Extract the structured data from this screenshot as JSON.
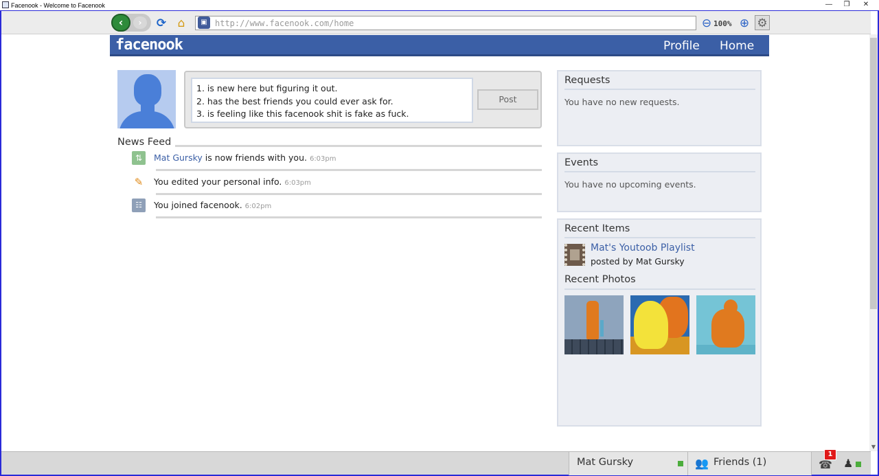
{
  "window": {
    "title": "Facenook - Welcome to Facenook",
    "minimize_glyph": "—",
    "restore_glyph": "❐",
    "close_glyph": "✕"
  },
  "browser": {
    "back_glyph": "‹",
    "forward_glyph": "›",
    "refresh_glyph": "⟳",
    "home_glyph": "⌂",
    "lock_glyph": "▣",
    "url": "http://www.facenook.com/home",
    "zoom_out_glyph": "⊖",
    "zoom": "100%",
    "zoom_in_glyph": "⊕",
    "settings_glyph": "⚙"
  },
  "site": {
    "logo": "facenook",
    "nav": {
      "profile": "Profile",
      "home": "Home"
    }
  },
  "status": {
    "lines": [
      "1. is new here but figuring it out.",
      "2. has the best friends you could ever ask for.",
      "3. is feeling like this facenook shit is fake as fuck."
    ],
    "post_label": "Post"
  },
  "news_feed": {
    "title": "News Feed",
    "items": [
      {
        "icon": "friend-icon",
        "glyph": "⇅",
        "link": "Mat Gursky",
        "text": " is now friends with you.",
        "time": "6:03pm"
      },
      {
        "icon": "pencil-icon",
        "glyph": "✎",
        "link": "",
        "text": "You edited your personal info.",
        "time": "6:03pm"
      },
      {
        "icon": "join-icon",
        "glyph": "☷",
        "link": "",
        "text": "You joined facenook.",
        "time": "6:02pm"
      }
    ]
  },
  "sidebar": {
    "requests": {
      "title": "Requests",
      "text": "You have no new requests."
    },
    "events": {
      "title": "Events",
      "text": "You have no upcoming events."
    },
    "recent_items": {
      "title": "Recent Items",
      "item_title": "Mat's Youtoob Playlist",
      "item_sub": "posted by Mat Gursky"
    },
    "recent_photos": {
      "title": "Recent Photos"
    }
  },
  "taskbar": {
    "user_name": "Mat Gursky",
    "friends_glyph": "👥",
    "friends_label": "Friends (1)",
    "notifications_glyph": "☎",
    "notification_count": "1",
    "status_glyph": "♟",
    "status_color": "#4cad3c"
  },
  "scrollbar": {
    "down_glyph": "▼"
  },
  "colors": {
    "brand": "#3b5fa6",
    "online": "#4cad3c",
    "badge": "#e01919"
  }
}
